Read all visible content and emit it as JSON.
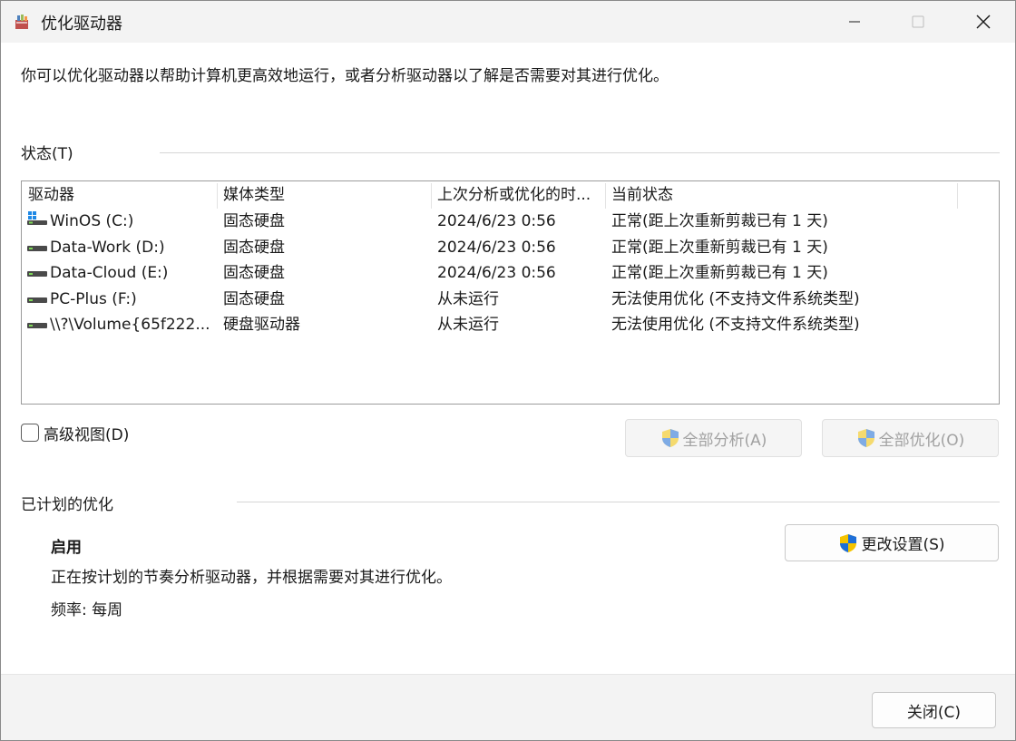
{
  "window": {
    "title": "优化驱动器",
    "app_icon": "defrag-app-icon"
  },
  "intro": "你可以优化驱动器以帮助计算机更高效地运行，或者分析驱动器以了解是否需要对其进行优化。",
  "status_group": {
    "label": "状态(T)",
    "columns": [
      "驱动器",
      "媒体类型",
      "上次分析或优化的时...",
      "当前状态"
    ],
    "rows": [
      {
        "drive": "WinOS (C:)",
        "icon": "windows-drive-icon",
        "media": "固态硬盘",
        "last": "2024/6/23 0:56",
        "status": "正常(距上次重新剪裁已有 1 天)"
      },
      {
        "drive": "Data-Work (D:)",
        "icon": "drive-icon",
        "media": "固态硬盘",
        "last": "2024/6/23 0:56",
        "status": "正常(距上次重新剪裁已有 1 天)"
      },
      {
        "drive": "Data-Cloud (E:)",
        "icon": "drive-icon",
        "media": "固态硬盘",
        "last": "2024/6/23 0:56",
        "status": "正常(距上次重新剪裁已有 1 天)"
      },
      {
        "drive": "PC-Plus (F:)",
        "icon": "drive-icon",
        "media": "固态硬盘",
        "last": "从未运行",
        "status": "无法使用优化 (不支持文件系统类型)"
      },
      {
        "drive": "\\\\?\\Volume{65f222...",
        "icon": "drive-icon",
        "media": "硬盘驱动器",
        "last": "从未运行",
        "status": "无法使用优化 (不支持文件系统类型)"
      }
    ]
  },
  "advanced_view": {
    "label": "高级视图(D)",
    "checked": false
  },
  "buttons": {
    "analyze_all": "全部分析(A)",
    "optimize_all": "全部优化(O)",
    "change_settings": "更改设置(S)",
    "close": "关闭(C)"
  },
  "scheduled": {
    "label": "已计划的优化",
    "status": "启用",
    "description": "正在按计划的节奏分析驱动器，并根据需要对其进行优化。",
    "frequency": "频率: 每周"
  },
  "colors": {
    "shield_blue": "#1e6fd9",
    "shield_yellow": "#f5c400"
  }
}
